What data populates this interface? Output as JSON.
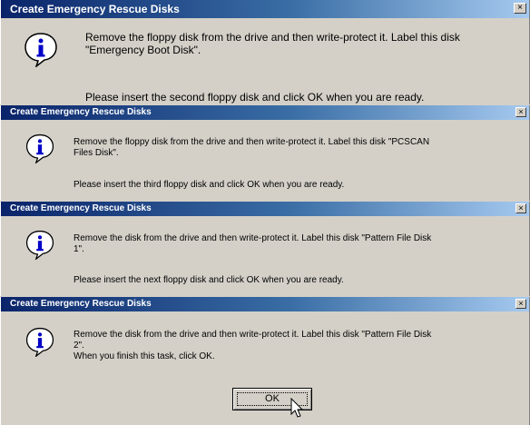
{
  "icon": "info-icon",
  "colors": {
    "titlebar_start": "#0a246a",
    "titlebar_end": "#a6caf0",
    "face": "#d4d0c8"
  },
  "dialogs": [
    {
      "title": "Create Emergency Rescue Disks",
      "close": "×",
      "message_line1": "Remove the floppy disk from the drive and then write-protect it. Label this disk",
      "message_line2": "\"Emergency Boot Disk\".",
      "prompt": "Please insert the second floppy disk and click OK when you are ready."
    },
    {
      "title": "Create Emergency Rescue Disks",
      "close": "×",
      "message_line1": "Remove the floppy disk from the drive and then write-protect it. Label this disk \"PCSCAN",
      "message_line2": "Files Disk\".",
      "prompt": "Please insert the third floppy disk and click OK when you are ready."
    },
    {
      "title": "Create Emergency Rescue Disks",
      "close": "×",
      "message_line1": "Remove the disk from the drive and then write-protect it. Label this disk \"Pattern File Disk",
      "message_line2": "1\".",
      "prompt": "Please insert the next floppy disk and click OK when you are ready."
    },
    {
      "title": "Create Emergency Rescue Disks",
      "close": "×",
      "message_line1": "Remove the disk from the drive and then write-protect it. Label this disk \"Pattern File Disk",
      "message_line2": "2\".",
      "prompt": "When you finish this task, click OK.",
      "ok_label": "OK"
    }
  ]
}
